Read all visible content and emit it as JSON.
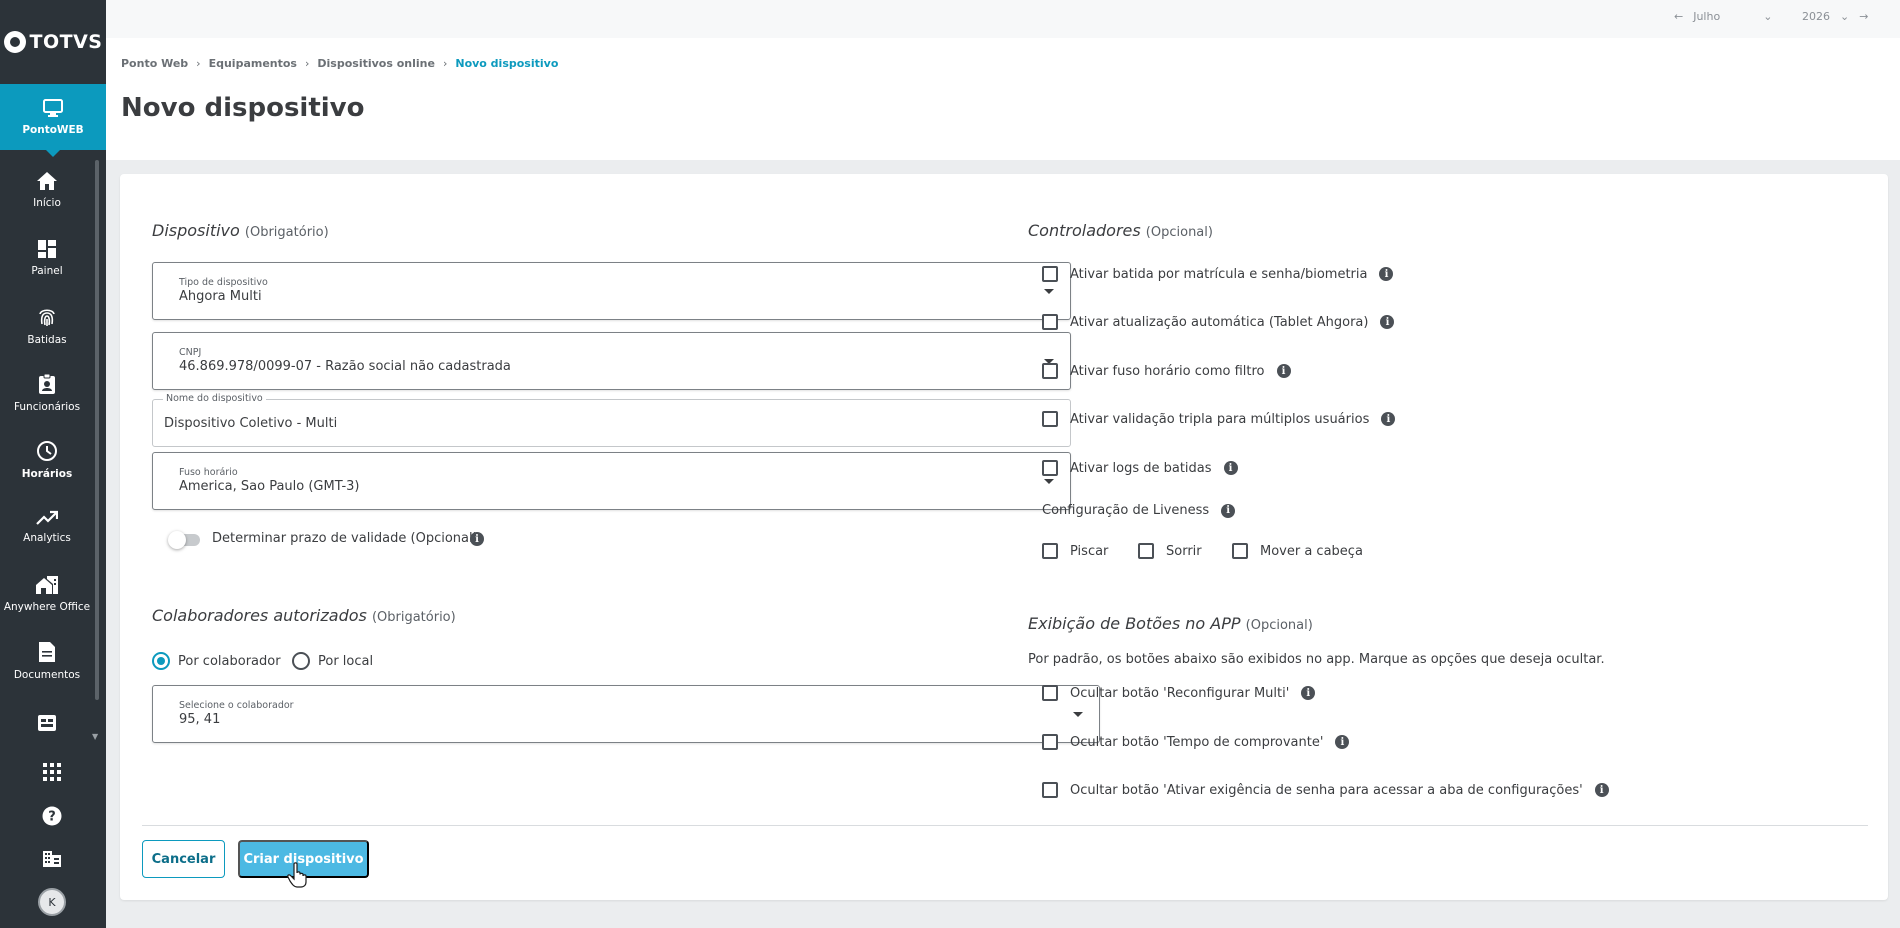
{
  "brand": {
    "name": "TOTVS"
  },
  "sidebar": {
    "active": {
      "label": "PontoWEB",
      "icon": "monitor-icon"
    },
    "items": [
      {
        "label": "Início",
        "icon": "home-icon"
      },
      {
        "label": "Painel",
        "icon": "dashboard-icon"
      },
      {
        "label": "Batidas",
        "icon": "fingerprint-icon"
      },
      {
        "label": "Funcionários",
        "icon": "badge-icon"
      },
      {
        "label": "Horários",
        "icon": "clock-icon"
      },
      {
        "label": "Analytics",
        "icon": "trending-up-icon"
      },
      {
        "label": "Anywhere Office",
        "icon": "home-work-icon"
      },
      {
        "label": "Documentos",
        "icon": "document-icon"
      }
    ],
    "bottom": [
      "apps-grid-icon",
      "help-icon",
      "company-icon"
    ],
    "user_initial": "K"
  },
  "topbar": {
    "month": "Julho",
    "year": "2026"
  },
  "breadcrumb": {
    "items": [
      "Ponto Web",
      "Equipamentos",
      "Dispositivos online"
    ],
    "current": "Novo dispositivo"
  },
  "page": {
    "title": "Novo dispositivo"
  },
  "dispositivo": {
    "title": "Dispositivo",
    "note": "(Obrigatório)",
    "tipo": {
      "label": "Tipo de dispositivo",
      "value": "Ahgora Multi"
    },
    "cnpj": {
      "label": "CNPJ",
      "value": "46.869.978/0099-07 - Razão social não cadastrada"
    },
    "nome": {
      "label": "Nome do dispositivo",
      "value": "Dispositivo Coletivo - Multi"
    },
    "fuso": {
      "label": "Fuso horário",
      "value": "America, Sao Paulo (GMT-3)"
    },
    "validade": {
      "label": "Determinar prazo de validade (Opcional)",
      "enabled": false
    }
  },
  "colaboradores": {
    "title": "Colaboradores autorizados",
    "note": "(Obrigatório)",
    "options": [
      "Por colaborador",
      "Por local"
    ],
    "selected": "Por colaborador",
    "select": {
      "label": "Selecione o colaborador",
      "value": "95, 41"
    }
  },
  "controladores": {
    "title": "Controladores",
    "note": "(Opcional)",
    "items": [
      "Ativar batida por matrícula e senha/biometria",
      "Ativar atualização automática (Tablet Ahgora)",
      "Ativar fuso horário como filtro",
      "Ativar validação tripla para múltiplos usuários",
      "Ativar logs de batidas"
    ],
    "liveness": {
      "label": "Configuração de Liveness",
      "options": [
        "Piscar",
        "Sorrir",
        "Mover a cabeça"
      ]
    }
  },
  "botoes_app": {
    "title": "Exibição de Botões no APP",
    "note": "(Opcional)",
    "description": "Por padrão, os botões abaixo são exibidos no app. Marque as opções que deseja ocultar.",
    "items": [
      "Ocultar botão 'Reconfigurar Multi'",
      "Ocultar botão 'Tempo de comprovante'",
      "Ocultar botão 'Ativar exigência de senha para acessar a aba de configurações'"
    ]
  },
  "actions": {
    "cancel": "Cancelar",
    "create": "Criar dispositivo"
  },
  "colors": {
    "accent": "#0c9abe",
    "sidebar": "#2c3339",
    "primary_button": "#4cb9e3"
  }
}
